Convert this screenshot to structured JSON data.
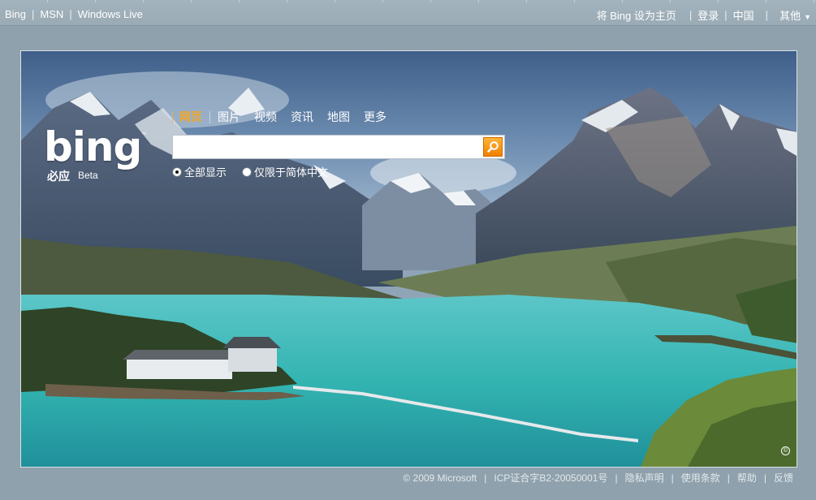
{
  "topbar": {
    "left_links": [
      {
        "label": "Bing"
      },
      {
        "label": "MSN"
      },
      {
        "label": "Windows Live"
      }
    ],
    "set_homepage": "将 Bing 设为主页",
    "sign_in": "登录",
    "region": "中国",
    "more": "其他"
  },
  "logo": {
    "word": "bing",
    "tm": "™",
    "chinese": "必应",
    "beta": "Beta"
  },
  "scopes": [
    {
      "label": "网页",
      "active": true
    },
    {
      "label": "图片"
    },
    {
      "label": "视频"
    },
    {
      "label": "资讯"
    },
    {
      "label": "地图"
    },
    {
      "label": "更多"
    }
  ],
  "search": {
    "value": "",
    "placeholder": ""
  },
  "options": {
    "all_results": "全部显示",
    "simplified_only": "仅限于简体中文",
    "selected": "all_results"
  },
  "copyright_badge": "©",
  "footer": {
    "copyright": "© 2009 Microsoft",
    "icp": "ICP证合字B2-20050001号",
    "privacy": "隐私声明",
    "terms": "使用条款",
    "help": "帮助",
    "feedback": "反馈"
  },
  "colors": {
    "page_bg": "#8fa1ac",
    "accent": "#f5a623",
    "search_button": "#f07f00",
    "lake": "#3dbfb8"
  },
  "icons": {
    "search_button": "magnifier-icon",
    "more_menu": "caret-down-icon"
  }
}
